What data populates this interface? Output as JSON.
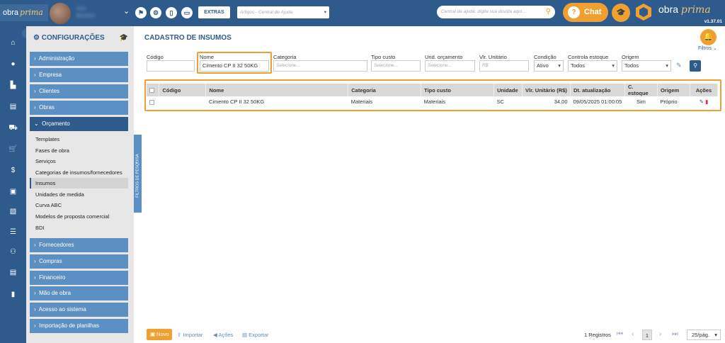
{
  "topbar": {
    "logo_text": "obra",
    "logo_italic": "prima",
    "user_name": "Ana",
    "user_sub": "Bonanni",
    "extras_label": "EXTRAS",
    "articles_placeholder": "Artigos - Central de Ajuda",
    "help_placeholder": "Central de ajuda: digite sua dúvida aqui...",
    "chat_label": "Chat",
    "brand_text": "obra",
    "brand_italic": "prima",
    "version": "v1.37.01"
  },
  "settings": {
    "title": "CONFIGURAÇÕES",
    "sections_top": [
      {
        "label": "Administração"
      },
      {
        "label": "Empresa"
      },
      {
        "label": "Clientes"
      },
      {
        "label": "Obras"
      }
    ],
    "open_section": "Orçamento",
    "orcamento_items": [
      {
        "label": "Templates"
      },
      {
        "label": "Fases de obra"
      },
      {
        "label": "Serviços"
      },
      {
        "label": "Categorias de insumos/fornecedores"
      },
      {
        "label": "Insumos"
      },
      {
        "label": "Unidades de medida"
      },
      {
        "label": "Curva ABC"
      },
      {
        "label": "Modelos de proposta comercial"
      },
      {
        "label": "BDI"
      }
    ],
    "active_item": "Insumos",
    "sections_bottom": [
      {
        "label": "Fornecedores"
      },
      {
        "label": "Compras"
      },
      {
        "label": "Financeiro"
      },
      {
        "label": "Mão de obra"
      },
      {
        "label": "Acesso ao sistema"
      },
      {
        "label": "Importação de planilhas"
      }
    ],
    "filter_tab": "FILTROS DE PESQUISA"
  },
  "page": {
    "title": "CADASTRO DE INSUMOS",
    "filtros_label": "Filtros"
  },
  "filters": {
    "codigo_label": "Código",
    "codigo_value": "",
    "nome_label": "Nome",
    "nome_value": "Cimento CP II 32 50KG",
    "categoria_label": "Categoria",
    "categoria_placeholder": "Selecione...",
    "tipo_custo_label": "Tipo custo",
    "tipo_custo_placeholder": "Selecione...",
    "und_orcamento_label": "Und. orçamento",
    "und_orcamento_placeholder": "Selecione...",
    "vlr_unitario_label": "Vlr. Unitário",
    "vlr_unitario_placeholder": "R$",
    "condicao_label": "Condição",
    "condicao_value": "Ativo",
    "controla_estoque_label": "Controla estoque",
    "controla_estoque_value": "Todos",
    "origem_label": "Origem",
    "origem_value": "Todos"
  },
  "table": {
    "headers": [
      "Código",
      "Nome",
      "Categoria",
      "Tipo custo",
      "Unidade",
      "Vlr. Unitário (R$)",
      "Dt. atualização",
      "C. estoque",
      "Origem",
      "Ações"
    ],
    "rows": [
      {
        "codigo": "",
        "nome": "Cimento CP II 32 50KG",
        "categoria": "Materiais",
        "tipo_custo": "Materiais",
        "unidade": "SC",
        "vlr_unitario": "34,00",
        "dt_atualizacao": "09/05/2025 01:00:05",
        "c_estoque": "Sim",
        "origem": "Próprio"
      }
    ]
  },
  "footer": {
    "novo_label": "Novo",
    "importar_label": "Importar",
    "acoes_label": "Ações",
    "exportar_label": "Exportar",
    "registros": "1 Registros",
    "current_page": "1",
    "per_page": "25/pág."
  },
  "colors": {
    "primary": "#2f5b8c",
    "section": "#5c8fc2",
    "accent": "#f0a030",
    "sidebar_bg": "#e7e7e7"
  }
}
